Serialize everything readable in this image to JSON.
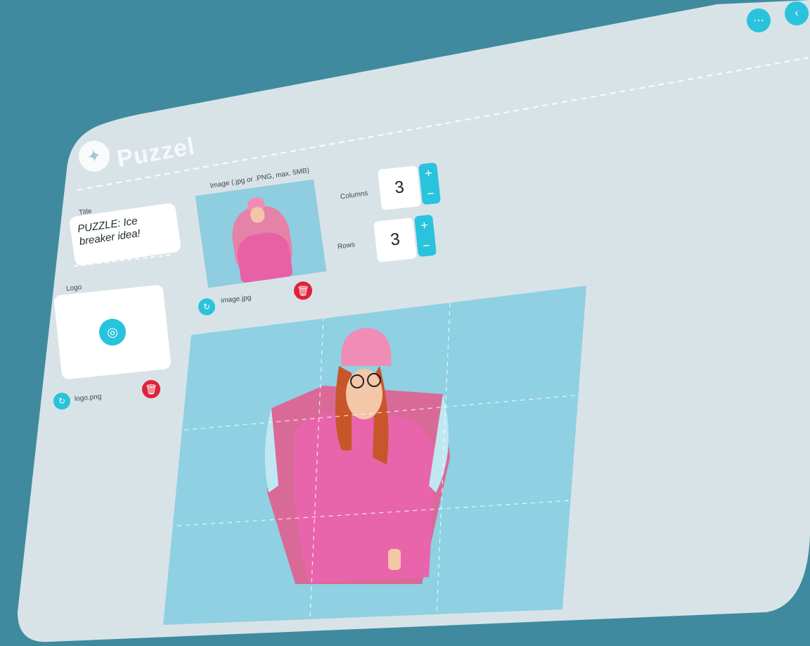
{
  "app": {
    "logo_text": "Puzzel"
  },
  "topbar": {
    "button1_icon": "ellipsis-icon",
    "button2_icon": "back-icon"
  },
  "sidebar": {
    "title_label": "Title",
    "title_value": "PUZZLE: Ice breaker idea!",
    "logo_label": "Logo",
    "upload_icon": "upload-icon",
    "logo_file": "logo.png"
  },
  "image_panel": {
    "label": "Image (.jpg or .PNG, max. 5MB)",
    "file_name": "image.jpg"
  },
  "grid": {
    "columns_label": "Columns",
    "columns_value": "3",
    "rows_label": "Rows",
    "rows_value": "3",
    "plus": "+",
    "minus": "−"
  },
  "colors": {
    "accent": "#29c3dd",
    "danger": "#e0213b",
    "background": "#3f8a9f",
    "panel": "#d8e3e8"
  }
}
